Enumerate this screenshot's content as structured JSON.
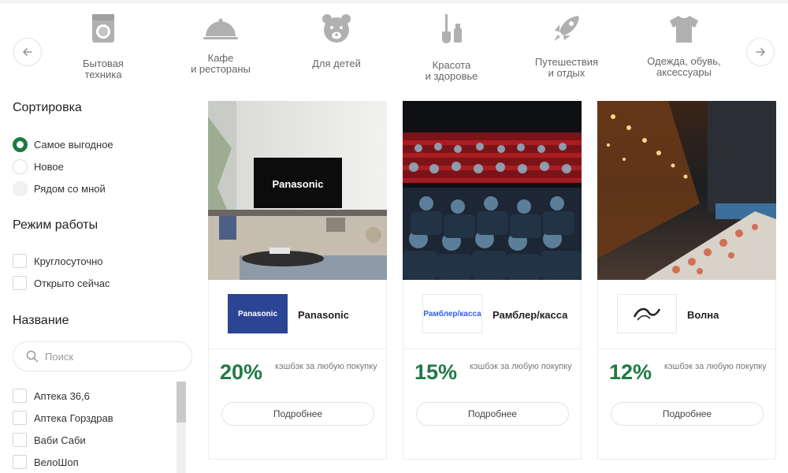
{
  "categories": [
    {
      "label": "Бытовая\nтехника",
      "icon": "washing-machine-icon"
    },
    {
      "label": "Кафе\nи рестораны",
      "icon": "cloche-icon"
    },
    {
      "label": "Для детей",
      "icon": "teddy-bear-icon"
    },
    {
      "label": "Красота\nи здоровье",
      "icon": "beauty-icon"
    },
    {
      "label": "Путешествия\nи отдых",
      "icon": "rocket-icon"
    },
    {
      "label": "Одежда, обувь,\nаксессуары",
      "icon": "tshirt-icon"
    }
  ],
  "sidebar": {
    "sort_title": "Сортировка",
    "sort_options": [
      "Самое выгодное",
      "Новое",
      "Рядом со мной"
    ],
    "sort_selected": "Самое выгодное",
    "hours_title": "Режим работы",
    "hours_options": [
      "Круглосуточно",
      "Открыто сейчас"
    ],
    "name_title": "Название",
    "search_placeholder": "Поиск",
    "names": [
      "Аптека 36,6",
      "Аптека Горздрав",
      "Ваби Саби",
      "ВелоШоп"
    ]
  },
  "cards": [
    {
      "logo_text": "Panasonic",
      "name": "Panasonic",
      "percent": "20%",
      "desc": "кэшбэк за любую покупку",
      "button": "Подробнее",
      "photo_text": "Panasonic"
    },
    {
      "logo_text": "Рамблер/касса",
      "name": "Рамблер/касса",
      "percent": "15%",
      "desc": "кэшбэк за любую покупку",
      "button": "Подробнее"
    },
    {
      "logo_text": "Волна",
      "name": "Волна",
      "percent": "12%",
      "desc": "кэшбэк за любую покупку",
      "button": "Подробнее"
    }
  ],
  "colors": {
    "accent": "#1f7a44",
    "panasonic_blue": "#2b4494",
    "rambler_blue": "#315efb"
  }
}
